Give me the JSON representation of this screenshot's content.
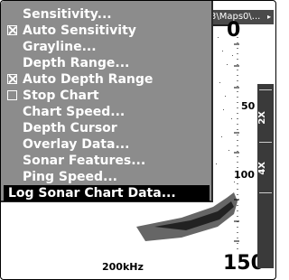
{
  "title_bar": {
    "text": "3\\Maps0\\...",
    "arrow": "▸"
  },
  "menu": {
    "items": [
      {
        "label": "Sensitivity...",
        "checkbox": null,
        "selected": false
      },
      {
        "label": "Auto Sensitivity",
        "checkbox": true,
        "selected": false
      },
      {
        "label": "Grayline...",
        "checkbox": null,
        "selected": false
      },
      {
        "label": "Depth Range...",
        "checkbox": null,
        "selected": false
      },
      {
        "label": "Auto Depth Range",
        "checkbox": true,
        "selected": false
      },
      {
        "label": "Stop Chart",
        "checkbox": false,
        "selected": false
      },
      {
        "label": "Chart Speed...",
        "checkbox": null,
        "selected": false
      },
      {
        "label": "Depth Cursor",
        "checkbox": null,
        "selected": false
      },
      {
        "label": "Overlay Data...",
        "checkbox": null,
        "selected": false
      },
      {
        "label": "Sonar Features...",
        "checkbox": null,
        "selected": false
      },
      {
        "label": "Ping Speed...",
        "checkbox": null,
        "selected": false
      },
      {
        "label": "Log Sonar Chart Data...",
        "checkbox": null,
        "selected": true
      }
    ]
  },
  "depth_scale": {
    "top": "0",
    "mid": "50",
    "lower": "100",
    "bottom": "150"
  },
  "frequency": "200kHz",
  "zoom": {
    "level_2x": "2X",
    "level_4x": "4X"
  },
  "colors": {
    "menu_bg": "#8c8c8c",
    "selected_bg": "#000000",
    "text": "#ffffff"
  }
}
